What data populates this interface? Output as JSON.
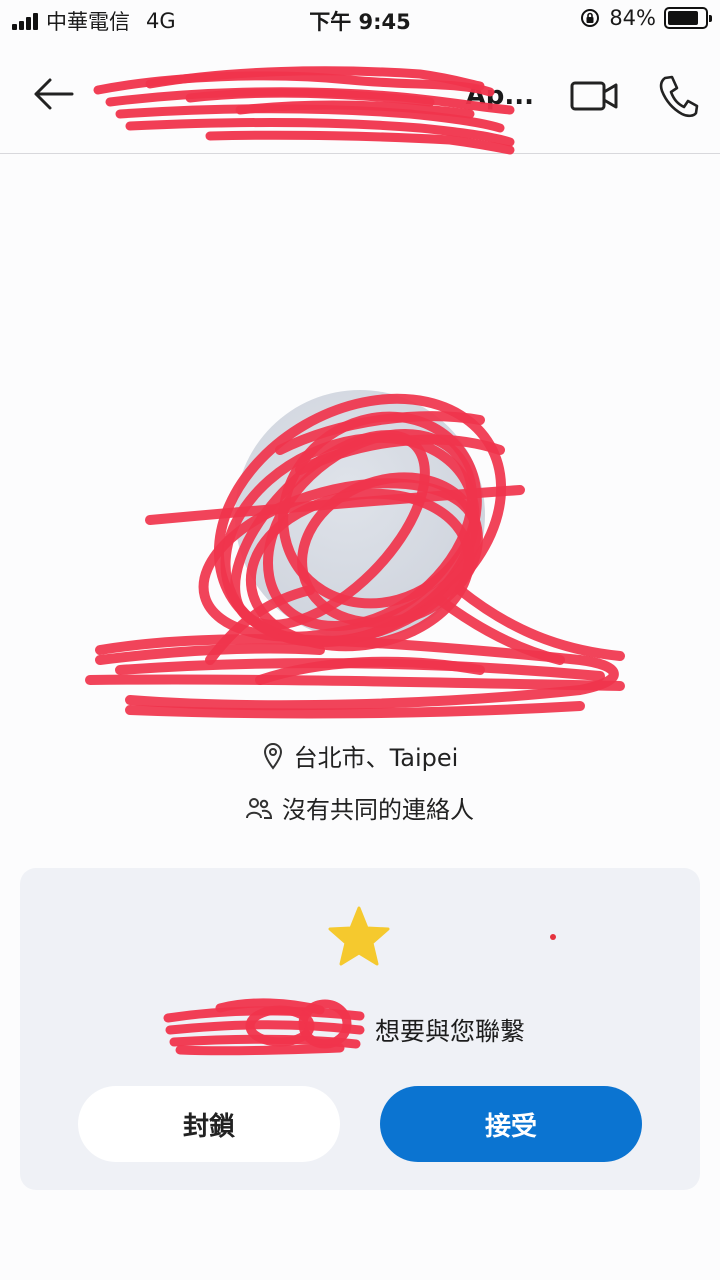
{
  "status_bar": {
    "carrier": "中華電信",
    "network": "4G",
    "time": "下午 9:45",
    "battery": "84%",
    "battery_level": 0.84
  },
  "header": {
    "title": "Ap...",
    "back_icon": "arrow-left-icon",
    "video_icon": "video-camera-icon",
    "call_icon": "phone-icon"
  },
  "profile": {
    "location": "台北市、Taipei",
    "mutual_contacts": "沒有共同的連絡人"
  },
  "request": {
    "message": "想要與您聯繫",
    "block_label": "封鎖",
    "accept_label": "接受"
  },
  "colors": {
    "accent": "#0b74d1",
    "card_bg": "#eff1f6",
    "redaction": "#f0344c",
    "star": "#f5c92e"
  }
}
